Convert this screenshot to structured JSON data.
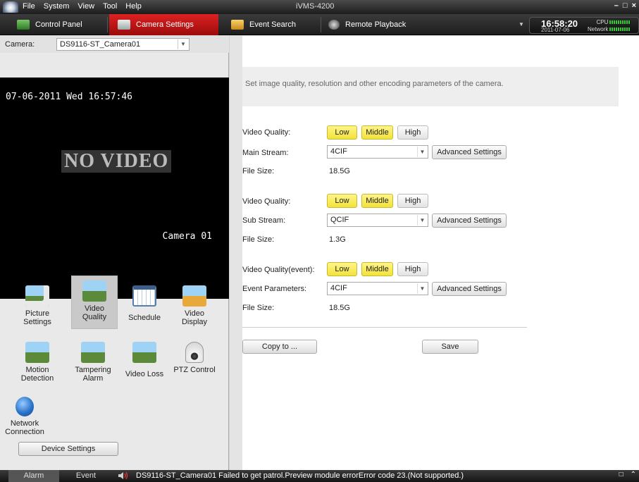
{
  "app": {
    "title": "iVMS-4200",
    "menu": [
      "File",
      "System",
      "View",
      "Tool",
      "Help"
    ]
  },
  "tabs": [
    {
      "label": "Control Panel",
      "icon": "control-panel-icon"
    },
    {
      "label": "Camera Settings",
      "icon": "camera-settings-icon",
      "active": true
    },
    {
      "label": "Event Search",
      "icon": "event-search-icon"
    },
    {
      "label": "Remote Playback",
      "icon": "remote-playback-icon"
    }
  ],
  "status": {
    "time": "16:58:20",
    "date": "2011-07-06",
    "cpu_label": "CPU",
    "network_label": "Network"
  },
  "camera": {
    "label": "Camera:",
    "selected": "DS9116-ST_Camera01"
  },
  "preview": {
    "osd_datetime": "07-06-2011 Wed 16:57:46",
    "no_video": "NO VIDEO",
    "osd_camera": "Camera 01"
  },
  "functions": [
    {
      "label": "Picture Settings",
      "icon": "picture-settings-icon"
    },
    {
      "label": "Video Quality",
      "icon": "video-quality-icon",
      "selected": true
    },
    {
      "label": "Schedule",
      "icon": "schedule-icon"
    },
    {
      "label": "Video Display",
      "icon": "video-display-icon"
    },
    {
      "label": "Motion Detection",
      "icon": "motion-detection-icon"
    },
    {
      "label": "Tampering Alarm",
      "icon": "tampering-alarm-icon"
    },
    {
      "label": "Video Loss",
      "icon": "video-loss-icon"
    },
    {
      "label": "PTZ Control",
      "icon": "ptz-control-icon"
    },
    {
      "label": "Network Connection",
      "icon": "network-connection-icon"
    }
  ],
  "device_settings_label": "Device Settings",
  "info_text": "Set image quality, resolution and other encoding parameters of the camera.",
  "quality_options": [
    "Low",
    "Middle",
    "High"
  ],
  "sections": [
    {
      "quality_label": "Video Quality:",
      "stream_label": "Main Stream:",
      "stream_value": "4CIF",
      "size_label": "File Size:",
      "size_value": "18.5G"
    },
    {
      "quality_label": "Video Quality:",
      "stream_label": "Sub Stream:",
      "stream_value": "QCIF",
      "size_label": "File Size:",
      "size_value": "1.3G"
    },
    {
      "quality_label": "Video Quality(event):",
      "stream_label": "Event Parameters:",
      "stream_value": "4CIF",
      "size_label": "File Size:",
      "size_value": "18.5G"
    }
  ],
  "advanced_label": "Advanced Settings",
  "copy_label": "Copy to ...",
  "save_label": "Save",
  "statusbar": {
    "tabs": [
      "Alarm",
      "Event"
    ],
    "message": "DS9116-ST_Camera01 Failed to get patrol.Preview module errorError code 23.(Not supported.)"
  },
  "colors": {
    "accent": "#c8161a",
    "quality_selected": "#f5e64a",
    "dark_bar": "#222222"
  }
}
